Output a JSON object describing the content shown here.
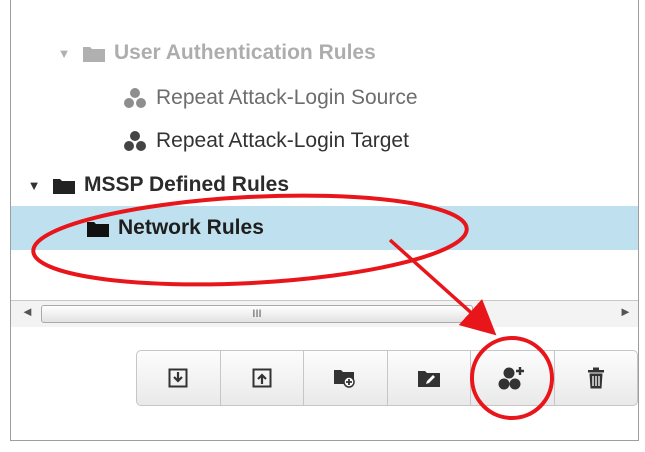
{
  "tree": {
    "items": [
      {
        "label": "User Authentication Rules",
        "type": "folder",
        "state": "expanded",
        "faded": true
      },
      {
        "label": "Repeat Attack-Login Source",
        "type": "rule"
      },
      {
        "label": "Repeat Attack-Login Target",
        "type": "rule"
      },
      {
        "label": "MSSP Defined Rules",
        "type": "folder",
        "state": "expanded"
      },
      {
        "label": "Network Rules",
        "type": "folder",
        "selected": true
      }
    ]
  },
  "scrollbar": {
    "left_arrow": "◄",
    "right_arrow": "►",
    "thumb_grip": "III"
  },
  "toolbar": {
    "buttons": [
      {
        "icon": "import-icon"
      },
      {
        "icon": "export-icon"
      },
      {
        "icon": "add-folder-icon"
      },
      {
        "icon": "edit-folder-icon"
      },
      {
        "icon": "add-rule-icon",
        "highlighted": true
      },
      {
        "icon": "delete-icon"
      }
    ]
  },
  "colors": {
    "selection": "#bfe0ee",
    "annotation": "#e8151b",
    "icon": "#333333"
  }
}
